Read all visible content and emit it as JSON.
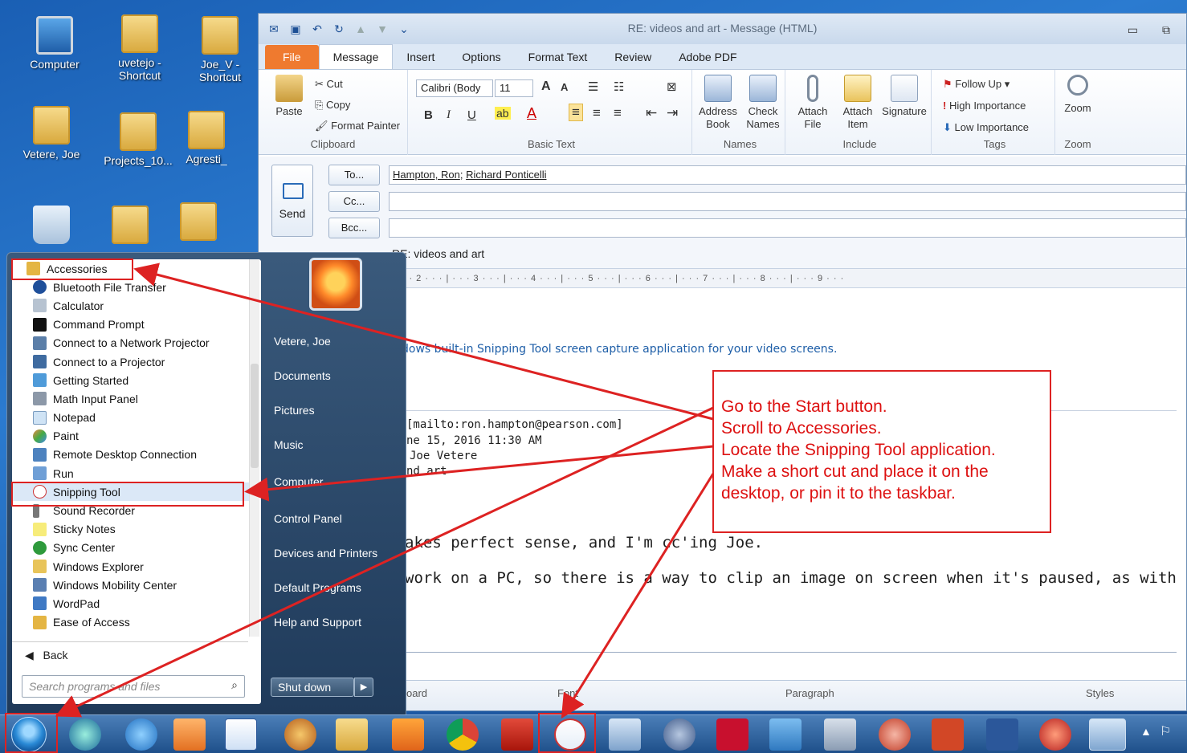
{
  "desktop": {
    "icons": [
      {
        "label": "Computer"
      },
      {
        "label": "uvetejo - Shortcut"
      },
      {
        "label": "Joe_V - Shortcut"
      },
      {
        "label": "Vetere, Joe"
      },
      {
        "label": "Projects_10..."
      },
      {
        "label": "Agresti_"
      }
    ]
  },
  "outlook": {
    "title": "RE: videos and art  -  Message (HTML)",
    "tabs": [
      "File",
      "Message",
      "Insert",
      "Options",
      "Format Text",
      "Review",
      "Adobe PDF"
    ],
    "clipboard": {
      "paste": "Paste",
      "cut": "Cut",
      "copy": "Copy",
      "format_painter": "Format Painter",
      "label": "Clipboard"
    },
    "basic_text": {
      "font": "Calibri (Body",
      "size": "11",
      "label": "Basic Text",
      "bold": "B",
      "italic": "I",
      "underline": "U"
    },
    "names": {
      "address_book": "Address Book",
      "check_names": "Check Names",
      "label": "Names"
    },
    "include": {
      "attach_file": "Attach File",
      "attach_item": "Attach Item",
      "signature": "Signature",
      "label": "Include"
    },
    "tags": {
      "follow_up": "Follow Up",
      "high": "High Importance",
      "low": "Low Importance",
      "label": "Tags"
    },
    "zoom": {
      "button": "Zoom",
      "label": "Zoom"
    },
    "compose": {
      "send": "Send",
      "to_btn": "To...",
      "cc_btn": "Cc...",
      "bcc_btn": "Bcc...",
      "to_recipients": [
        "Hampton, Ron",
        "Richard Ponticelli"
      ],
      "subject": "RE: videos and art"
    },
    "ruler_text": "· · · 2 · · · | · · · 3 · · · | · · · 4 · · · | · · · 5 · · · | · · · 6 · · · | · · · 7 · · · | · · · 8 · · · | · · · 9 · · ·",
    "body": {
      "line1": "dows built-in Snipping Tool screen capture application for your video screens.",
      "mailto": "[mailto:ron.hampton@pearson.com]",
      "date": "ne 15, 2016 11:30 AM",
      "to": "Joe Vetere",
      "subj": "nd art",
      "line2": "akes perfect sense, and I'm cc'ing Joe.",
      "line3": "work on a PC, so there is a way to clip an image on screen when it's paused, as with a video, but"
    },
    "bottom_groups": {
      "board": "oard",
      "font": "Font",
      "paragraph": "Paragraph",
      "styles": "Styles"
    }
  },
  "start_menu": {
    "programs": [
      "Accessories",
      "Bluetooth File Transfer",
      "Calculator",
      "Command Prompt",
      "Connect to a Network Projector",
      "Connect to a Projector",
      "Getting Started",
      "Math Input Panel",
      "Notepad",
      "Paint",
      "Remote Desktop Connection",
      "Run",
      "Snipping Tool",
      "Sound Recorder",
      "Sticky Notes",
      "Sync Center",
      "Windows Explorer",
      "Windows Mobility Center",
      "WordPad",
      "Ease of Access"
    ],
    "back": "Back",
    "search_placeholder": "Search programs and files",
    "right_items": [
      "Vetere, Joe",
      "Documents",
      "Pictures",
      "Music",
      "Computer",
      "Control Panel",
      "Devices and Printers",
      "Default Programs",
      "Help and Support"
    ],
    "shutdown": "Shut down"
  },
  "callout": {
    "lines": [
      "Go to the Start button.",
      "Scroll to Accessories.",
      "Locate the Snipping Tool application.",
      "Make a short cut and place it on the",
      "desktop, or pin it to the taskbar."
    ]
  },
  "colors": {
    "annotation": "#dd2222",
    "file_tab": "#ef7a2f",
    "taskbar": "#2a5f9e"
  }
}
